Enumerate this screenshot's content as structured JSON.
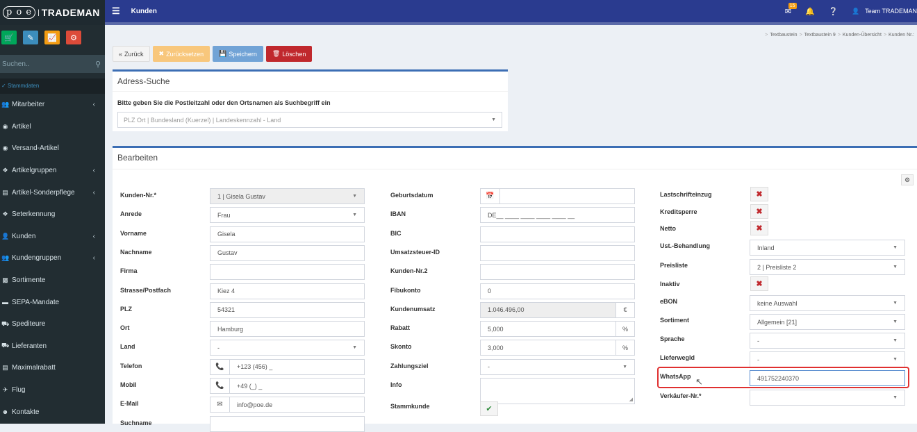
{
  "logo": {
    "mark": "p o e",
    "name": "TRADEMAN"
  },
  "sidebar": {
    "search_placeholder": "Suchen..",
    "section": "Stammdaten",
    "items": [
      {
        "label": "Mitarbeiter",
        "icon": "users-icon",
        "chevron": true
      },
      {
        "label": "Artikel",
        "icon": "cube-icon",
        "chevron": false
      },
      {
        "label": "Versand-Artikel",
        "icon": "cube-icon",
        "chevron": false
      },
      {
        "label": "Artikelgruppen",
        "icon": "cubes-icon",
        "chevron": true
      },
      {
        "label": "Artikel-Sonderpflege",
        "icon": "list-icon",
        "chevron": true
      },
      {
        "label": "Seterkennung",
        "icon": "cubes-icon",
        "chevron": false
      },
      {
        "label": "Kunden",
        "icon": "user-icon",
        "chevron": true
      },
      {
        "label": "Kundengruppen",
        "icon": "users-icon",
        "chevron": true
      },
      {
        "label": "Sortimente",
        "icon": "sitemap-icon",
        "chevron": false
      },
      {
        "label": "SEPA-Mandate",
        "icon": "credit-card-icon",
        "chevron": false
      },
      {
        "label": "Spediteure",
        "icon": "truck-icon",
        "chevron": false
      },
      {
        "label": "Lieferanten",
        "icon": "truck-icon",
        "chevron": false
      },
      {
        "label": "Maximalrabatt",
        "icon": "money-icon",
        "chevron": false
      },
      {
        "label": "Flug",
        "icon": "plane-icon",
        "chevron": false
      },
      {
        "label": "Kontakte",
        "icon": "contact-icon",
        "chevron": false
      }
    ]
  },
  "topbar": {
    "title": "Kunden",
    "mail_badge": "15",
    "user": "Team TRADEMAN"
  },
  "breadcrumb": [
    "Textbaustein",
    "Textbaustein 9",
    "Kunden-Übersicht",
    "Kunden Nr.:"
  ],
  "actions": {
    "back": "Zurück",
    "reset": "Zurücksetzen",
    "save": "Speichern",
    "delete": "Löschen"
  },
  "address_search": {
    "title": "Adress-Suche",
    "label": "Bitte geben Sie die Postleitzahl oder den Ortsnamen als Suchbegriff ein",
    "placeholder": "PLZ Ort | Bundesland (Kuerzel) | Landeskennzahl - Land"
  },
  "edit": {
    "title": "Bearbeiten",
    "col1": [
      {
        "label": "Kunden-Nr.*",
        "value": "1 | Gisela Gustav",
        "type": "select",
        "readonly": true
      },
      {
        "label": "Anrede",
        "value": "Frau",
        "type": "select"
      },
      {
        "label": "Vorname",
        "value": "Gisela",
        "type": "text"
      },
      {
        "label": "Nachname",
        "value": "Gustav",
        "type": "text"
      },
      {
        "label": "Firma",
        "value": "",
        "type": "text"
      },
      {
        "label": "Strasse/Postfach",
        "value": "Kiez 4",
        "type": "text"
      },
      {
        "label": "PLZ",
        "value": "54321",
        "type": "text"
      },
      {
        "label": "Ort",
        "value": "Hamburg",
        "type": "text"
      },
      {
        "label": "Land",
        "value": "-",
        "type": "select"
      },
      {
        "label": "Telefon",
        "value": "+123 (456) _",
        "type": "phone"
      },
      {
        "label": "Mobil",
        "value": "+49 (_) _",
        "type": "phone"
      },
      {
        "label": "E-Mail",
        "value": "info@poe.de",
        "type": "mail"
      },
      {
        "label": "Suchname",
        "value": "",
        "type": "text"
      }
    ],
    "col2": [
      {
        "label": "Geburtsdatum",
        "value": "",
        "type": "date"
      },
      {
        "label": "IBAN",
        "value": "DE__ ____ ____ ____ ____ __",
        "type": "text"
      },
      {
        "label": "BIC",
        "value": "",
        "type": "text"
      },
      {
        "label": "Umsatzsteuer-ID",
        "value": "",
        "type": "text"
      },
      {
        "label": "Kunden-Nr.2",
        "value": "",
        "type": "text"
      },
      {
        "label": "Fibukonto",
        "value": "0",
        "type": "text"
      },
      {
        "label": "Kundenumsatz",
        "value": "1.046.496,00",
        "type": "suffix",
        "suffix": "€",
        "readonly": true
      },
      {
        "label": "Rabatt",
        "value": "5,000",
        "type": "suffix",
        "suffix": "%"
      },
      {
        "label": "Skonto",
        "value": "3,000",
        "type": "suffix",
        "suffix": "%"
      },
      {
        "label": "Zahlungsziel",
        "value": "-",
        "type": "select"
      },
      {
        "label": "Info",
        "value": "",
        "type": "textarea"
      },
      {
        "label": "Stammkunde",
        "value": "",
        "type": "check"
      }
    ],
    "col3": [
      {
        "label": "Lastschrifteinzug",
        "type": "x"
      },
      {
        "label": "Kreditsperre",
        "type": "x"
      },
      {
        "label": "Netto",
        "type": "x"
      },
      {
        "label": "Ust.-Behandlung",
        "value": "Inland",
        "type": "select"
      },
      {
        "label": "Preisliste",
        "value": "2 | Preisliste 2",
        "type": "select"
      },
      {
        "label": "Inaktiv",
        "type": "x"
      },
      {
        "label": "eBON",
        "value": "keine Auswahl",
        "type": "select"
      },
      {
        "label": "Sortiment",
        "value": "Allgemein [21]",
        "type": "select"
      },
      {
        "label": "Sprache",
        "value": "-",
        "type": "select"
      },
      {
        "label": "LieferwegId",
        "value": "-",
        "type": "select"
      },
      {
        "label": "WhatsApp",
        "value": "491752240370",
        "type": "text"
      },
      {
        "label": "Verkäufer-Nr.*",
        "value": "",
        "type": "select"
      }
    ]
  },
  "colors": {
    "topbar": "#2a3b8f",
    "sidebar": "#222d32",
    "save": "#71a3d6",
    "delete": "#c0282d",
    "reset": "#f8c77c",
    "highlight": "#e03030"
  }
}
